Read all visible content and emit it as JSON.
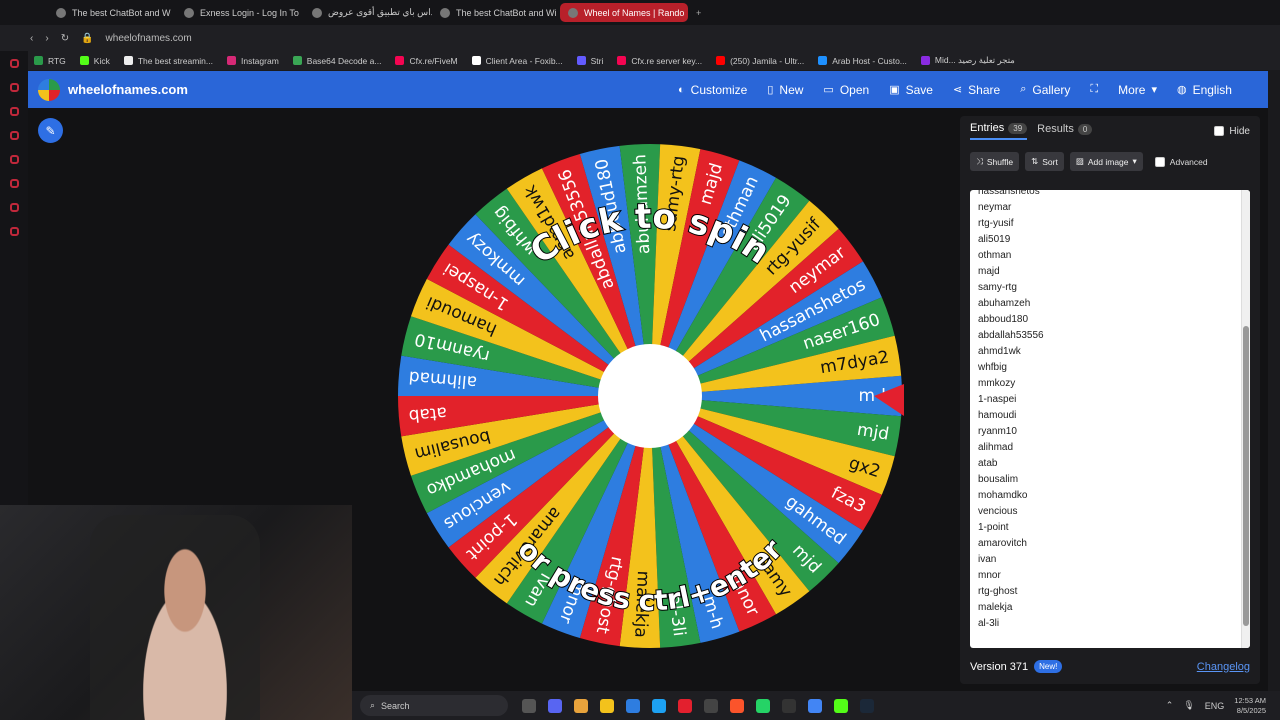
{
  "browser": {
    "tabs": [
      {
        "title": "The best ChatBot and W"
      },
      {
        "title": "Exness Login - Log In To"
      },
      {
        "title": "ميداس باي تطبيق أقوى عروض"
      },
      {
        "title": "The best ChatBot and Wi"
      },
      {
        "title": "Wheel of Names | Rando"
      }
    ],
    "url": "wheelofnames.com",
    "bookmarks": [
      "RTG",
      "Kick",
      "The best streamin...",
      "Instagram",
      "Base64 Decode a...",
      "Cfx.re/FiveM",
      "Client Area - Foxib...",
      "Stri",
      "Cfx.re server key...",
      "(250) Jamila - Ultr...",
      "Arab Host - Custo...",
      "Mid... متجر تعلية رصيد"
    ]
  },
  "app": {
    "title": "wheelofnames.com",
    "menu": {
      "customize": "Customize",
      "new": "New",
      "open": "Open",
      "save": "Save",
      "share": "Share",
      "gallery": "Gallery",
      "more": "More",
      "language": "English"
    },
    "colors": {
      "accent": "#2a66d8",
      "green": "#2a9a4a",
      "red": "#e2222a",
      "yellow": "#f3c21c",
      "blue": "#2e7de0"
    }
  },
  "wheel": {
    "center_text_top": "Click to spin",
    "center_text_bottom": "or press ctrl+enter",
    "labels": [
      "m-h",
      "mjd",
      "gx2",
      "fza3",
      "gahmed",
      "mjd",
      "samy",
      "mnor",
      "m-h",
      "al-3li",
      "malekja",
      "rtg-ghost",
      "mnor",
      "ivan",
      "amarovitch",
      "1-point",
      "vencious",
      "mohamdko",
      "bousalim",
      "atab",
      "alihmad",
      "ryanm10",
      "hamoudi",
      "1-naspei",
      "mmkozy",
      "whfbig",
      "ahmd1wk",
      "abdallah53556",
      "abboud180",
      "abuhamzeh",
      "samy-rtg",
      "majd",
      "othman",
      "ali5019",
      "rtg-yusif",
      "neymar",
      "hassanshetos",
      "naser160",
      "m7dya2"
    ]
  },
  "panel": {
    "tab_entries": "Entries",
    "entries_count": "39",
    "tab_results": "Results",
    "results_count": "0",
    "hide_label": "Hide",
    "shuffle": "Shuffle",
    "sort": "Sort",
    "add_image": "Add image",
    "advanced": "Advanced",
    "entries": [
      "hassanshetos",
      "neymar",
      "rtg-yusif",
      "ali5019",
      "othman",
      "majd",
      "samy-rtg",
      "abuhamzeh",
      "abboud180",
      "abdallah53556",
      "ahmd1wk",
      "whfbig",
      "mmkozy",
      "1-naspei",
      "hamoudi",
      "ryanm10",
      "alihmad",
      "atab",
      "bousalim",
      "mohamdko",
      "vencious",
      "1-point",
      "amarovitch",
      "ivan",
      "mnor",
      "rtg-ghost",
      "malekja",
      "al-3li"
    ],
    "version": "Version 371",
    "new_badge": "New!",
    "changelog": "Changelog"
  },
  "taskbar": {
    "search": "Search",
    "lang": "ENG",
    "time": "12:53 AM",
    "date": "8/5/2025"
  }
}
